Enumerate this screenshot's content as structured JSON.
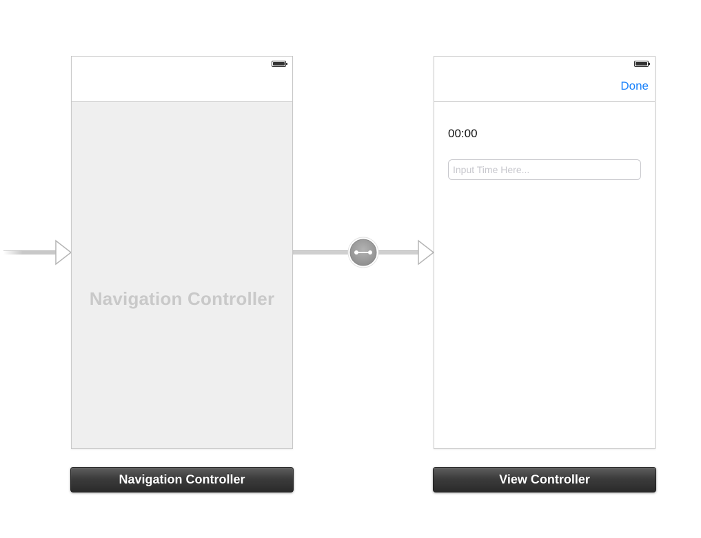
{
  "navigation_controller": {
    "placeholder_text": "Navigation Controller",
    "scene_label": "Navigation Controller"
  },
  "view_controller": {
    "nav_bar": {
      "done_button_label": "Done"
    },
    "time_label": "00:00",
    "time_input": {
      "value": "",
      "placeholder": "Input Time Here..."
    },
    "scene_label": "View Controller"
  },
  "segue": {
    "icon": "segue-link-icon"
  },
  "entry_point": {
    "icon": "initial-view-controller-arrow-icon"
  },
  "colors": {
    "accent": "#1a82fb",
    "canvas": "#ffffff",
    "nav_body": "#efefef",
    "label_bar": "#3c3c3c"
  }
}
